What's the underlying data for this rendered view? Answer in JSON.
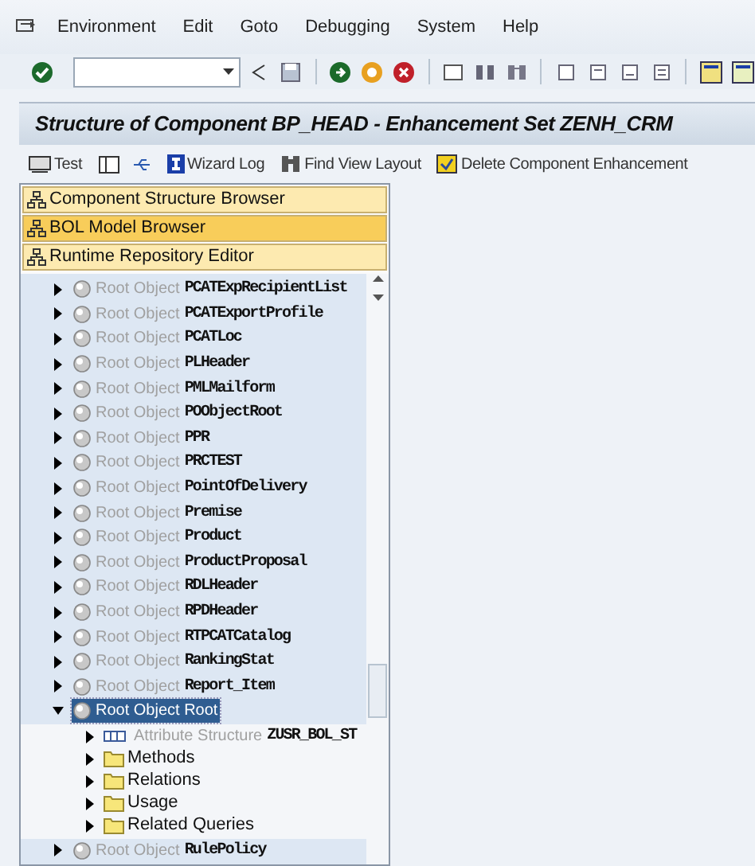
{
  "menu": [
    "Environment",
    "Edit",
    "Goto",
    "Debugging",
    "System",
    "Help"
  ],
  "title": "Structure of Component BP_HEAD - Enhancement Set ZENH_CRM",
  "app_toolbar": [
    {
      "kind": "test",
      "label": "Test"
    },
    {
      "kind": "layout"
    },
    {
      "kind": "wizard",
      "label": "Wizard Log"
    },
    {
      "kind": "find",
      "label": "Find View Layout"
    },
    {
      "kind": "delete",
      "label": "Delete Component Enhancement"
    }
  ],
  "panels": [
    {
      "label": "Component Structure Browser",
      "selected": false
    },
    {
      "label": "BOL Model Browser",
      "selected": true
    },
    {
      "label": "Runtime Repository Editor",
      "selected": false
    }
  ],
  "tree": [
    {
      "prefix": "Root Object",
      "name": "PCATExpRecipientList",
      "expanded": false,
      "selected": false
    },
    {
      "prefix": "Root Object",
      "name": "PCATExportProfile",
      "expanded": false,
      "selected": false
    },
    {
      "prefix": "Root Object",
      "name": "PCATLoc",
      "expanded": false,
      "selected": false
    },
    {
      "prefix": "Root Object",
      "name": "PLHeader",
      "expanded": false,
      "selected": false
    },
    {
      "prefix": "Root Object",
      "name": "PMLMailform",
      "expanded": false,
      "selected": false
    },
    {
      "prefix": "Root Object",
      "name": "POObjectRoot",
      "expanded": false,
      "selected": false
    },
    {
      "prefix": "Root Object",
      "name": "PPR",
      "expanded": false,
      "selected": false
    },
    {
      "prefix": "Root Object",
      "name": "PRCTEST",
      "expanded": false,
      "selected": false
    },
    {
      "prefix": "Root Object",
      "name": "PointOfDelivery",
      "expanded": false,
      "selected": false
    },
    {
      "prefix": "Root Object",
      "name": "Premise",
      "expanded": false,
      "selected": false
    },
    {
      "prefix": "Root Object",
      "name": "Product",
      "expanded": false,
      "selected": false
    },
    {
      "prefix": "Root Object",
      "name": "ProductProposal",
      "expanded": false,
      "selected": false
    },
    {
      "prefix": "Root Object",
      "name": "RDLHeader",
      "expanded": false,
      "selected": false
    },
    {
      "prefix": "Root Object",
      "name": "RPDHeader",
      "expanded": false,
      "selected": false
    },
    {
      "prefix": "Root Object",
      "name": "RTPCATCatalog",
      "expanded": false,
      "selected": false
    },
    {
      "prefix": "Root Object",
      "name": "RankingStat",
      "expanded": false,
      "selected": false
    },
    {
      "prefix": "Root Object",
      "name": "Report_Item",
      "expanded": false,
      "selected": false
    },
    {
      "prefix": "Root Object Root",
      "expanded": true,
      "selected": true,
      "children": [
        {
          "kind": "attribute",
          "prefix": "Attribute Structure",
          "name": "ZUSR_BOL_ST"
        },
        {
          "kind": "folder",
          "label": "Methods"
        },
        {
          "kind": "folder",
          "label": "Relations"
        },
        {
          "kind": "folder",
          "label": "Usage"
        },
        {
          "kind": "folder",
          "label": "Related Queries"
        }
      ]
    },
    {
      "prefix": "Root Object",
      "name": "RulePolicy",
      "expanded": false,
      "selected": false
    }
  ]
}
